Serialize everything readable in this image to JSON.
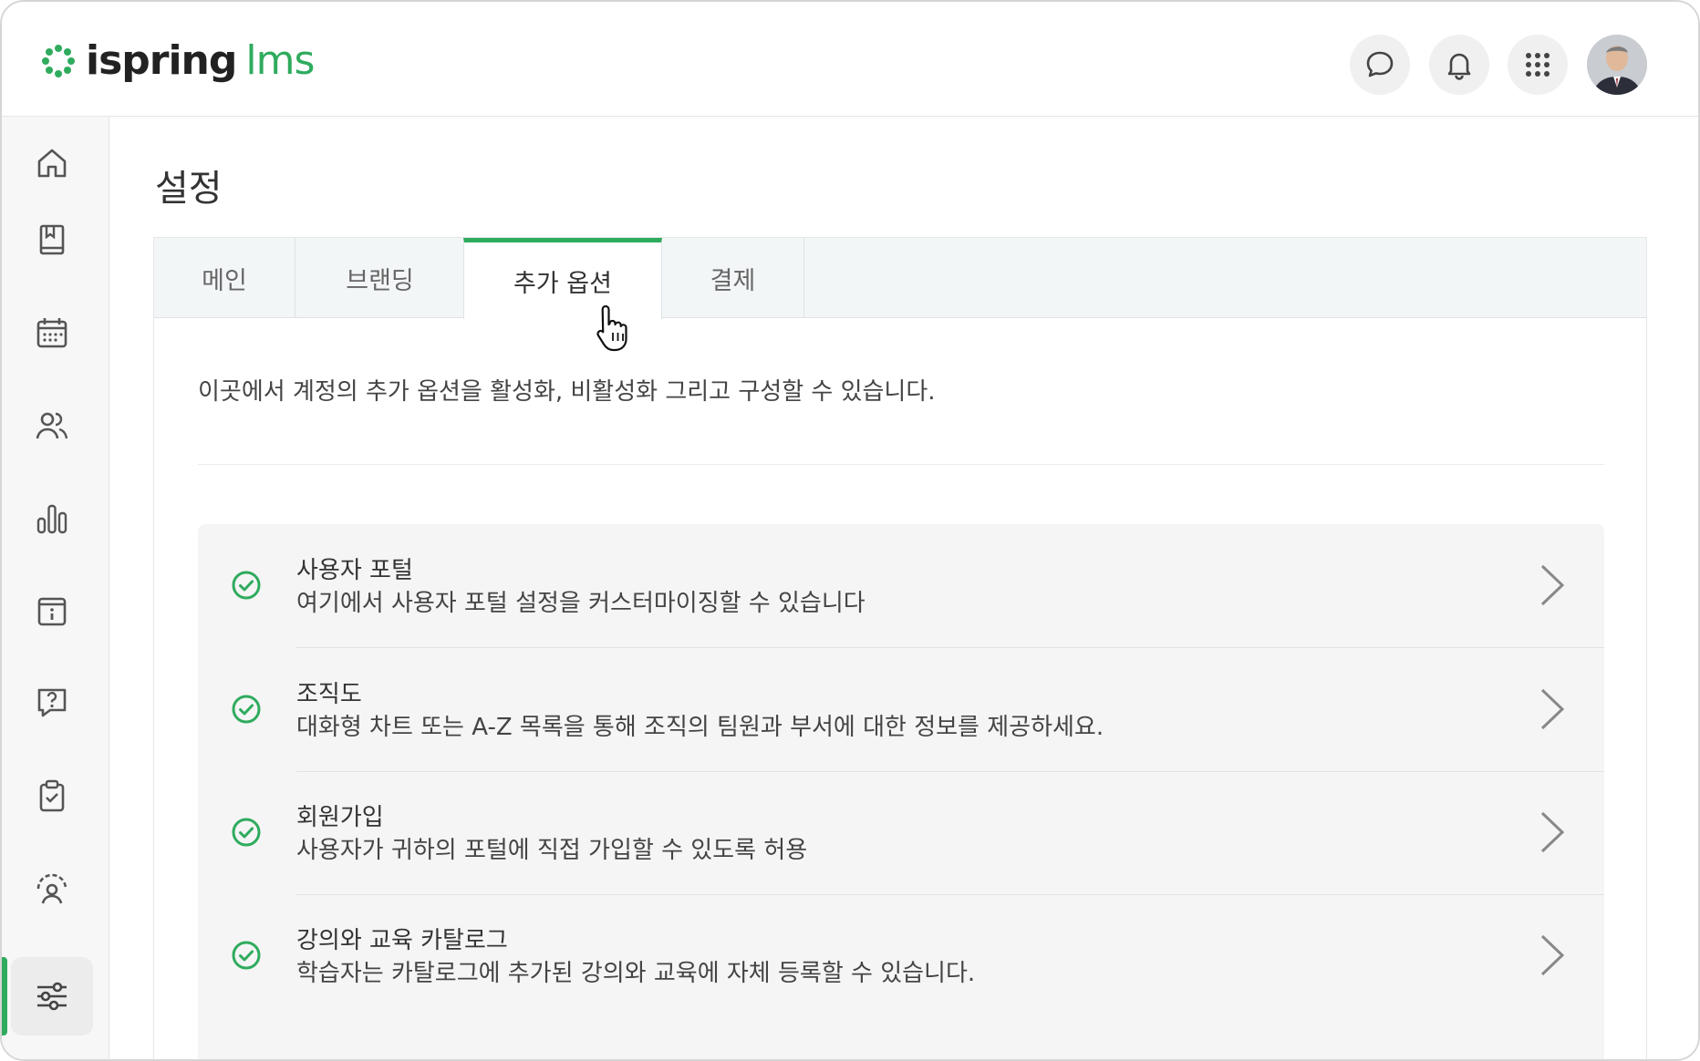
{
  "header": {
    "logo_word1": "ispring",
    "logo_word2": "lms",
    "buttons": [
      {
        "name": "chat-button",
        "icon": "chat-bubble-icon"
      },
      {
        "name": "notifications-button",
        "icon": "bell-icon"
      },
      {
        "name": "apps-button",
        "icon": "grid-icon"
      }
    ],
    "avatar": "user-avatar"
  },
  "sidebar": {
    "items": [
      {
        "icon": "home-icon"
      },
      {
        "icon": "book-icon"
      },
      {
        "icon": "calendar-icon"
      },
      {
        "icon": "users-icon"
      },
      {
        "icon": "bar-chart-icon"
      },
      {
        "icon": "info-page-icon"
      },
      {
        "icon": "question-icon"
      },
      {
        "icon": "clipboard-check-icon"
      },
      {
        "icon": "user-gauge-icon"
      },
      {
        "icon": "sliders-icon",
        "active": true
      }
    ]
  },
  "page": {
    "title": "설정"
  },
  "tabs": [
    {
      "label": "메인"
    },
    {
      "label": "브랜딩"
    },
    {
      "label": "추가 옵션",
      "active": true
    },
    {
      "label": "결제"
    }
  ],
  "main": {
    "description": "이곳에서 계정의 추가 옵션을 활성화, 비활성화 그리고 구성할 수 있습니다."
  },
  "options": [
    {
      "title": "사용자 포털",
      "subtitle": "여기에서 사용자 포털 설정을 커스터마이징할 수 있습니다"
    },
    {
      "title": "조직도",
      "subtitle": "대화형 차트 또는 A-Z 목록을 통해 조직의 팀원과 부서에 대한 정보를 제공하세요."
    },
    {
      "title": "회원가입",
      "subtitle": "사용자가 귀하의 포털에 직접 가입할 수 있도록 허용"
    },
    {
      "title": "강의와 교육 카탈로그",
      "subtitle": "학습자는 카탈로그에 추가된 강의와 교육에 자체 등록할 수 있습니다."
    }
  ],
  "colors": {
    "accent": "#2fab5e",
    "icon": "#555555"
  }
}
